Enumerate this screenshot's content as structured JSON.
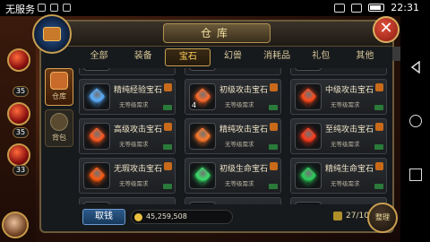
{
  "status_bar": {
    "carrier": "无服务",
    "time": "22:31"
  },
  "window": {
    "title": "仓库",
    "close_label": "✕",
    "tabs": [
      {
        "label": "全部",
        "active": false
      },
      {
        "label": "装备",
        "active": false
      },
      {
        "label": "宝石",
        "active": true
      },
      {
        "label": "幻兽",
        "active": false
      },
      {
        "label": "消耗品",
        "active": false
      },
      {
        "label": "礼包",
        "active": false
      },
      {
        "label": "其他",
        "active": false
      }
    ],
    "side_tabs": [
      {
        "label": "仓库",
        "active": true
      },
      {
        "label": "背包",
        "active": false
      }
    ]
  },
  "items": [
    {
      "name": "精纯经验宝石",
      "req": "无等级需求",
      "count": "",
      "gem_color": "#5ab0ff"
    },
    {
      "name": "初级攻击宝石",
      "req": "无等级需求",
      "count": "4",
      "gem_color": "#ff6a2a"
    },
    {
      "name": "中级攻击宝石",
      "req": "无等级需求",
      "count": "",
      "gem_color": "#ff4a1a"
    },
    {
      "name": "高级攻击宝石",
      "req": "无等级需求",
      "count": "",
      "gem_color": "#ff5a20"
    },
    {
      "name": "精纯攻击宝石",
      "req": "无等级需求",
      "count": "",
      "gem_color": "#ff7a2a"
    },
    {
      "name": "至纯攻击宝石",
      "req": "无等级需求",
      "count": "",
      "gem_color": "#ff3a1a"
    },
    {
      "name": "无瑕攻击宝石",
      "req": "无等级需求",
      "count": "",
      "gem_color": "#ff5a10"
    },
    {
      "name": "初级生命宝石",
      "req": "无等级需求",
      "count": "",
      "gem_color": "#3adf6a"
    },
    {
      "name": "精纯生命宝石",
      "req": "无等级需求",
      "count": "",
      "gem_color": "#2acf5a"
    },
    {
      "name": "",
      "req": "",
      "count": "",
      "gem_color": ""
    },
    {
      "name": "",
      "req": "",
      "count": "",
      "gem_color": ""
    },
    {
      "name": "",
      "req": "",
      "count": "",
      "gem_color": ""
    }
  ],
  "top_partial_counts": [
    "3",
    "3",
    "3"
  ],
  "bottom": {
    "take_label": "取钱",
    "money": "45,259,508",
    "capacity": "27/106",
    "sort_label": "整理"
  },
  "left_orbs": [
    {
      "level": "35"
    },
    {
      "level": "35"
    },
    {
      "level": "33"
    }
  ]
}
